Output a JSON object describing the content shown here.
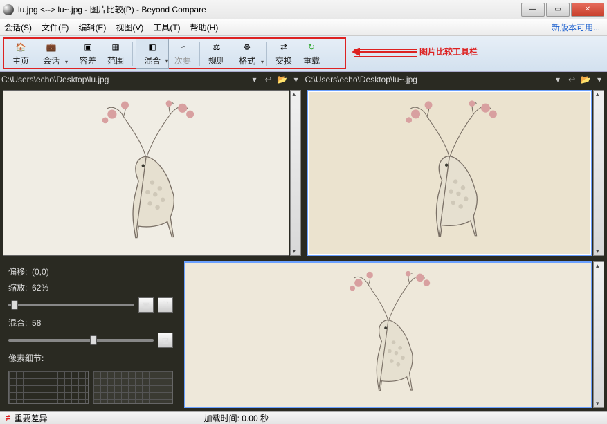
{
  "title": "lu.jpg <--> lu~.jpg - 图片比较(P) - Beyond Compare",
  "menu": {
    "session": "会话(S)",
    "file": "文件(F)",
    "edit": "编辑(E)",
    "view": "视图(V)",
    "tools": "工具(T)",
    "help": "帮助(H)",
    "newversion": "新版本可用..."
  },
  "tools": {
    "home": "主页",
    "session": "会话",
    "tolerance": "容差",
    "range": "范围",
    "blend": "混合",
    "secondary": "次要",
    "rules": "规则",
    "format": "格式",
    "swap": "交换",
    "reload": "重载"
  },
  "callout": "图片比较工具栏",
  "paths": {
    "left": "C:\\Users\\echo\\Desktop\\lu.jpg",
    "right": "C:\\Users\\echo\\Desktop\\lu~.jpg"
  },
  "controls": {
    "offset_label": "偏移:",
    "offset_value": "(0,0)",
    "zoom_label": "缩放:",
    "zoom_value": "62%",
    "blend_label": "混合:",
    "blend_value": "58",
    "pixdetail": "像素细节:"
  },
  "status": {
    "neq": "≠",
    "diff": "重要差异",
    "load": "加载时间: 0.00 秒"
  },
  "colors": {
    "accent": "#d22"
  }
}
